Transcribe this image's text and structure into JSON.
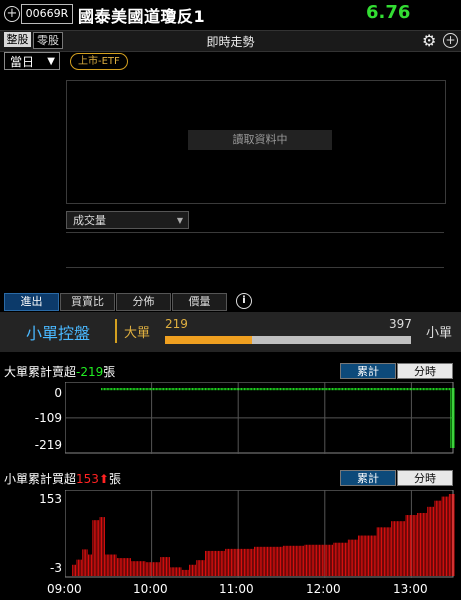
{
  "header": {
    "stock_code": "00669R",
    "stock_name": "國泰美國道瓊反1",
    "price": "6.76"
  },
  "tabs": {
    "whole_lot": "整股",
    "odd_lot": "零股",
    "title": "即時走勢"
  },
  "period": {
    "value": "當日"
  },
  "badge": "上市-ETF",
  "chart": {
    "loading_text": "讀取資料中",
    "indicator": "成交量"
  },
  "subtabs": [
    "進出",
    "買賣比",
    "分佈",
    "價量"
  ],
  "control": {
    "label": "小單控盤",
    "big_label": "大單",
    "small_label": "小單",
    "big_value": "219",
    "small_value": "397",
    "big_share": 0.355
  },
  "big_panel": {
    "title_prefix": "大單累計賣超",
    "title_value": "-219",
    "title_suffix": "張",
    "seg_cum": "累計",
    "seg_time": "分時"
  },
  "small_panel": {
    "title_prefix": "小單累計買超",
    "title_value": "153",
    "title_suffix": "張",
    "seg_cum": "累計",
    "seg_time": "分時"
  },
  "colors": {
    "green": "#22ee22",
    "red": "#ee1111",
    "accent": "#e0b040",
    "blue": "#4ab8ff"
  },
  "chart_data": [
    {
      "type": "bar",
      "title": "大單累計賣超-219張",
      "ylim": [
        -219,
        0
      ],
      "yticks": [
        "0",
        "-109",
        "-219"
      ],
      "x_start": "09:00",
      "x_end": "13:30",
      "series": [
        {
          "values_by_minute_from_0925": "flat near -8 from 09:25 to 13:26, then drops to -219 at 13:27-13:30"
        }
      ],
      "segments": [
        {
          "from": "09:25",
          "to": "13:26",
          "value": -8
        },
        {
          "from": "13:27",
          "to": "13:30",
          "value": -219
        }
      ]
    },
    {
      "type": "bar",
      "title": "小單累計買超153張",
      "ylim": [
        -3,
        153
      ],
      "yticks": [
        "153",
        "-3"
      ],
      "xticks": [
        "09:00",
        "10:00",
        "11:00",
        "12:00",
        "13:00"
      ],
      "segments": [
        {
          "from": "09:05",
          "to": "09:07",
          "value": 15
        },
        {
          "from": "09:08",
          "to": "09:11",
          "value": 25
        },
        {
          "from": "09:12",
          "to": "09:15",
          "value": 45
        },
        {
          "from": "09:16",
          "to": "09:18",
          "value": 35
        },
        {
          "from": "09:19",
          "to": "09:23",
          "value": 102
        },
        {
          "from": "09:24",
          "to": "09:27",
          "value": 108
        },
        {
          "from": "09:28",
          "to": "09:35",
          "value": 35
        },
        {
          "from": "09:36",
          "to": "09:45",
          "value": 28
        },
        {
          "from": "09:46",
          "to": "09:55",
          "value": 22
        },
        {
          "from": "09:56",
          "to": "10:05",
          "value": 20
        },
        {
          "from": "10:06",
          "to": "10:12",
          "value": 30
        },
        {
          "from": "10:13",
          "to": "10:20",
          "value": 10
        },
        {
          "from": "10:21",
          "to": "10:25",
          "value": 5
        },
        {
          "from": "10:26",
          "to": "10:30",
          "value": 15
        },
        {
          "from": "10:31",
          "to": "10:36",
          "value": 24
        },
        {
          "from": "10:37",
          "to": "10:50",
          "value": 42
        },
        {
          "from": "10:51",
          "to": "11:10",
          "value": 46
        },
        {
          "from": "11:11",
          "to": "11:30",
          "value": 50
        },
        {
          "from": "11:31",
          "to": "11:45",
          "value": 52
        },
        {
          "from": "11:46",
          "to": "12:05",
          "value": 54
        },
        {
          "from": "12:06",
          "to": "12:15",
          "value": 58
        },
        {
          "from": "12:16",
          "to": "12:22",
          "value": 64
        },
        {
          "from": "12:23",
          "to": "12:35",
          "value": 72
        },
        {
          "from": "12:36",
          "to": "12:45",
          "value": 88
        },
        {
          "from": "12:46",
          "to": "12:55",
          "value": 100
        },
        {
          "from": "12:56",
          "to": "13:03",
          "value": 112
        },
        {
          "from": "13:04",
          "to": "13:10",
          "value": 116
        },
        {
          "from": "13:11",
          "to": "13:15",
          "value": 128
        },
        {
          "from": "13:16",
          "to": "13:20",
          "value": 140
        },
        {
          "from": "13:21",
          "to": "13:25",
          "value": 148
        },
        {
          "from": "13:26",
          "to": "13:30",
          "value": 153
        }
      ]
    }
  ]
}
